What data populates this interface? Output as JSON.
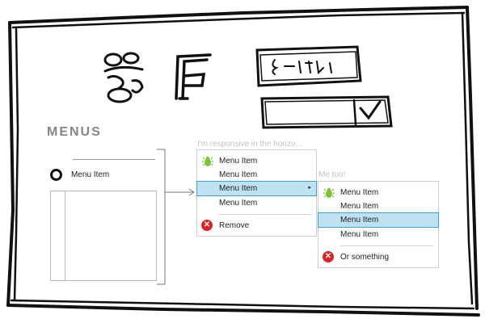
{
  "section_title": "MENUS",
  "left_panel": {
    "item_label": "Menu Item",
    "radio_icon": "radio-ring-icon"
  },
  "menu_1": {
    "caption": "I'm responsive in the horizo...",
    "items": [
      {
        "label": "Menu Item",
        "icon": "bug-icon",
        "selected": false
      },
      {
        "label": "Menu Item",
        "icon": "",
        "selected": false
      },
      {
        "label": "Menu Item",
        "icon": "",
        "selected": true,
        "submenu_arrow": "▸"
      },
      {
        "label": "Menu Item",
        "icon": "",
        "selected": false
      }
    ],
    "remove_label": "Remove",
    "remove_icon": "close-circle-icon"
  },
  "menu_2": {
    "caption": "Me too!",
    "items": [
      {
        "label": "Menu Item",
        "icon": "bug-icon",
        "selected": false
      },
      {
        "label": "Menu Item",
        "icon": "",
        "selected": false
      },
      {
        "label": "Menu Item",
        "icon": "",
        "selected": true
      },
      {
        "label": "Menu Item",
        "icon": "",
        "selected": false
      }
    ],
    "other_label": "Or something",
    "other_icon": "close-circle-icon"
  },
  "colors": {
    "selection_fill": "#bfe2f3",
    "selection_border": "#3aa2d6",
    "bug_green": "#7cc433",
    "danger_red": "#e02424"
  }
}
